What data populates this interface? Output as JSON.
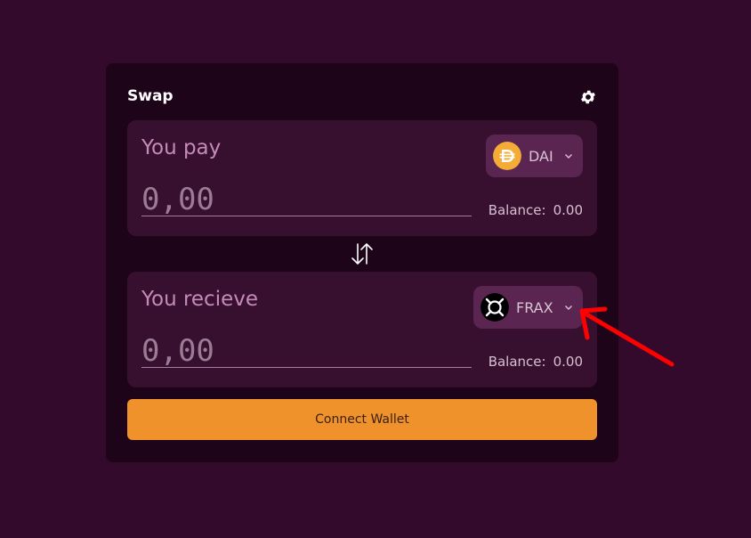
{
  "swap": {
    "title": "Swap",
    "settings_icon": "gear-icon",
    "pay": {
      "label": "You pay",
      "amount_placeholder": "0,00",
      "token": {
        "symbol": "DAI",
        "icon": "dai-token-icon",
        "color": "#f5ac37"
      },
      "balance_label": "Balance:",
      "balance_value": "0.00"
    },
    "switch_icon": "swap-arrows-icon",
    "receive": {
      "label": "You recieve",
      "amount_placeholder": "0,00",
      "token": {
        "symbol": "FRAX",
        "icon": "frax-token-icon",
        "color": "#000000"
      },
      "balance_label": "Balance:",
      "balance_value": "0.00"
    },
    "connect_label": "Connect Wallet"
  },
  "colors": {
    "page_bg": "#33092c",
    "card_bg": "#1e0419",
    "panel_bg": "#38102f",
    "token_button_bg": "#5a2550",
    "accent": "#ef922c",
    "annotation_arrow": "#ff0000"
  },
  "annotation": {
    "icon": "red-arrow-annotation"
  }
}
